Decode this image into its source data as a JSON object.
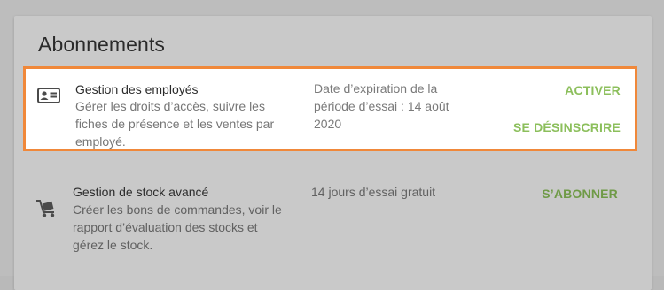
{
  "section": {
    "title": "Abonnements"
  },
  "subscriptions": [
    {
      "name": "Gestion des employés",
      "description": "Gérer les droits d’accès, suivre les fiches de présence et les ventes par employé.",
      "status": "Date d’expiration de la période d’essai : 14 août 2020",
      "icon": "id-card-icon",
      "actions": [
        "ACTIVER",
        "SE DÉSINSCRIRE"
      ]
    },
    {
      "name": "Gestion de stock avancé",
      "description": "Créer les bons de commandes, voir le rapport d’évaluation des stocks et gérez le stock.",
      "status": "14 jours d’essai gratuit",
      "icon": "hand-truck-icon",
      "actions": [
        "S’ABONNER"
      ]
    }
  ],
  "colors": {
    "highlight_border": "#f0883a",
    "action_green": "#8cbf5c"
  }
}
